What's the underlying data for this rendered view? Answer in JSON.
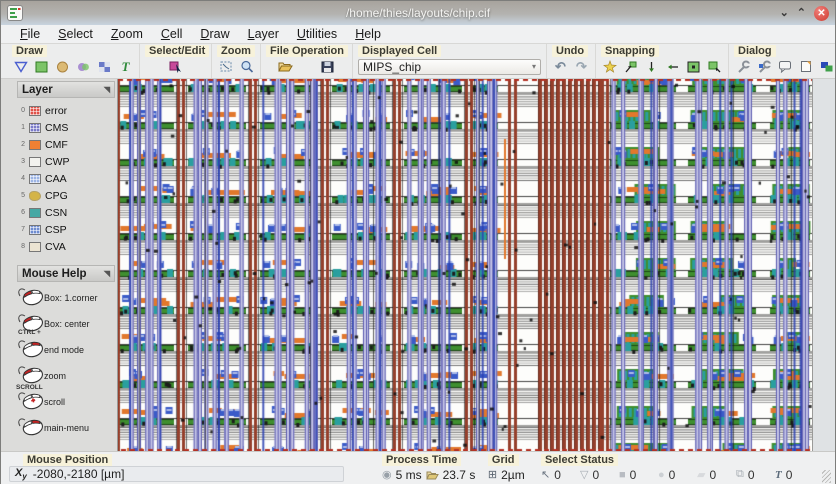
{
  "window": {
    "title": "/home/thies/layouts/chip.cif"
  },
  "menu": {
    "items": [
      {
        "label": "File"
      },
      {
        "label": "Select"
      },
      {
        "label": "Zoom"
      },
      {
        "label": "Cell"
      },
      {
        "label": "Draw"
      },
      {
        "label": "Layer"
      },
      {
        "label": "Utilities"
      },
      {
        "label": "Help"
      }
    ]
  },
  "toolbar": {
    "groups": [
      {
        "label": "Draw"
      },
      {
        "label": "Select/Edit"
      },
      {
        "label": "Zoom"
      },
      {
        "label": "File Operation"
      },
      {
        "label": "Displayed Cell"
      },
      {
        "label": "Undo"
      },
      {
        "label": "Snapping"
      },
      {
        "label": "Dialog"
      }
    ],
    "cell_combo": {
      "value": "MIPS_chip"
    }
  },
  "layers": {
    "title": "Layer",
    "items": [
      {
        "index": "0",
        "name": "error",
        "color": "#e05148"
      },
      {
        "index": "1",
        "name": "CMS",
        "color": "#7a7ac8"
      },
      {
        "index": "2",
        "name": "CMF",
        "color": "#ef8033"
      },
      {
        "index": "3",
        "name": "CWP",
        "color": "#f2f2ee"
      },
      {
        "index": "4",
        "name": "CAA",
        "color": "#9cb4e4"
      },
      {
        "index": "5",
        "name": "CPG",
        "color": "#d4b448"
      },
      {
        "index": "6",
        "name": "CSN",
        "color": "#46a8a4"
      },
      {
        "index": "7",
        "name": "CSP",
        "color": "#6e8cd0"
      },
      {
        "index": "8",
        "name": "CVA",
        "color": "#ece4d2"
      }
    ]
  },
  "mouse_help": {
    "title": "Mouse Help",
    "items": [
      {
        "label": "Box: 1.corner",
        "modifier": ""
      },
      {
        "label": "Box: center",
        "modifier": "CTRL +"
      },
      {
        "label": "end mode",
        "modifier": ""
      },
      {
        "label": "zoom",
        "modifier": ""
      },
      {
        "label": "scroll",
        "modifier": "SCROLL"
      },
      {
        "label": "main-menu",
        "modifier": ""
      }
    ]
  },
  "status": {
    "mouse_position": {
      "label": "Mouse Position",
      "glyph_x": "X",
      "glyph_y": "y",
      "value": "-2080,-2180 [µm]"
    },
    "process_time": {
      "label": "Process Time",
      "cpu": "5 ms",
      "total": "23.7 s"
    },
    "grid": {
      "label": "Grid",
      "value": "2µm"
    },
    "select_status": {
      "label": "Select Status",
      "counters": [
        {
          "icon": "select-arrow",
          "count": "0"
        },
        {
          "icon": "polygon",
          "count": "0"
        },
        {
          "icon": "box",
          "count": "0"
        },
        {
          "icon": "circle",
          "count": "0"
        },
        {
          "icon": "path",
          "count": "0"
        },
        {
          "icon": "instance",
          "count": "0"
        },
        {
          "icon": "text",
          "count": "0"
        }
      ]
    }
  },
  "canvas": {
    "palette": {
      "bg": "#fdfdfb",
      "brown": "#96402c",
      "purple": "#5757ae",
      "purple_light": "#c9c9e8",
      "green": "#3f8f2f",
      "green_dark": "#1c4a14",
      "teal": "#2a9f9f",
      "orange": "#e2782c",
      "blue": "#3a5bc8",
      "dark": "#1c1c1c",
      "red_dash": "#b43326"
    }
  },
  "ui": {
    "label_chip_bg": "#f7f2da",
    "close_red": "#cf3a30"
  }
}
